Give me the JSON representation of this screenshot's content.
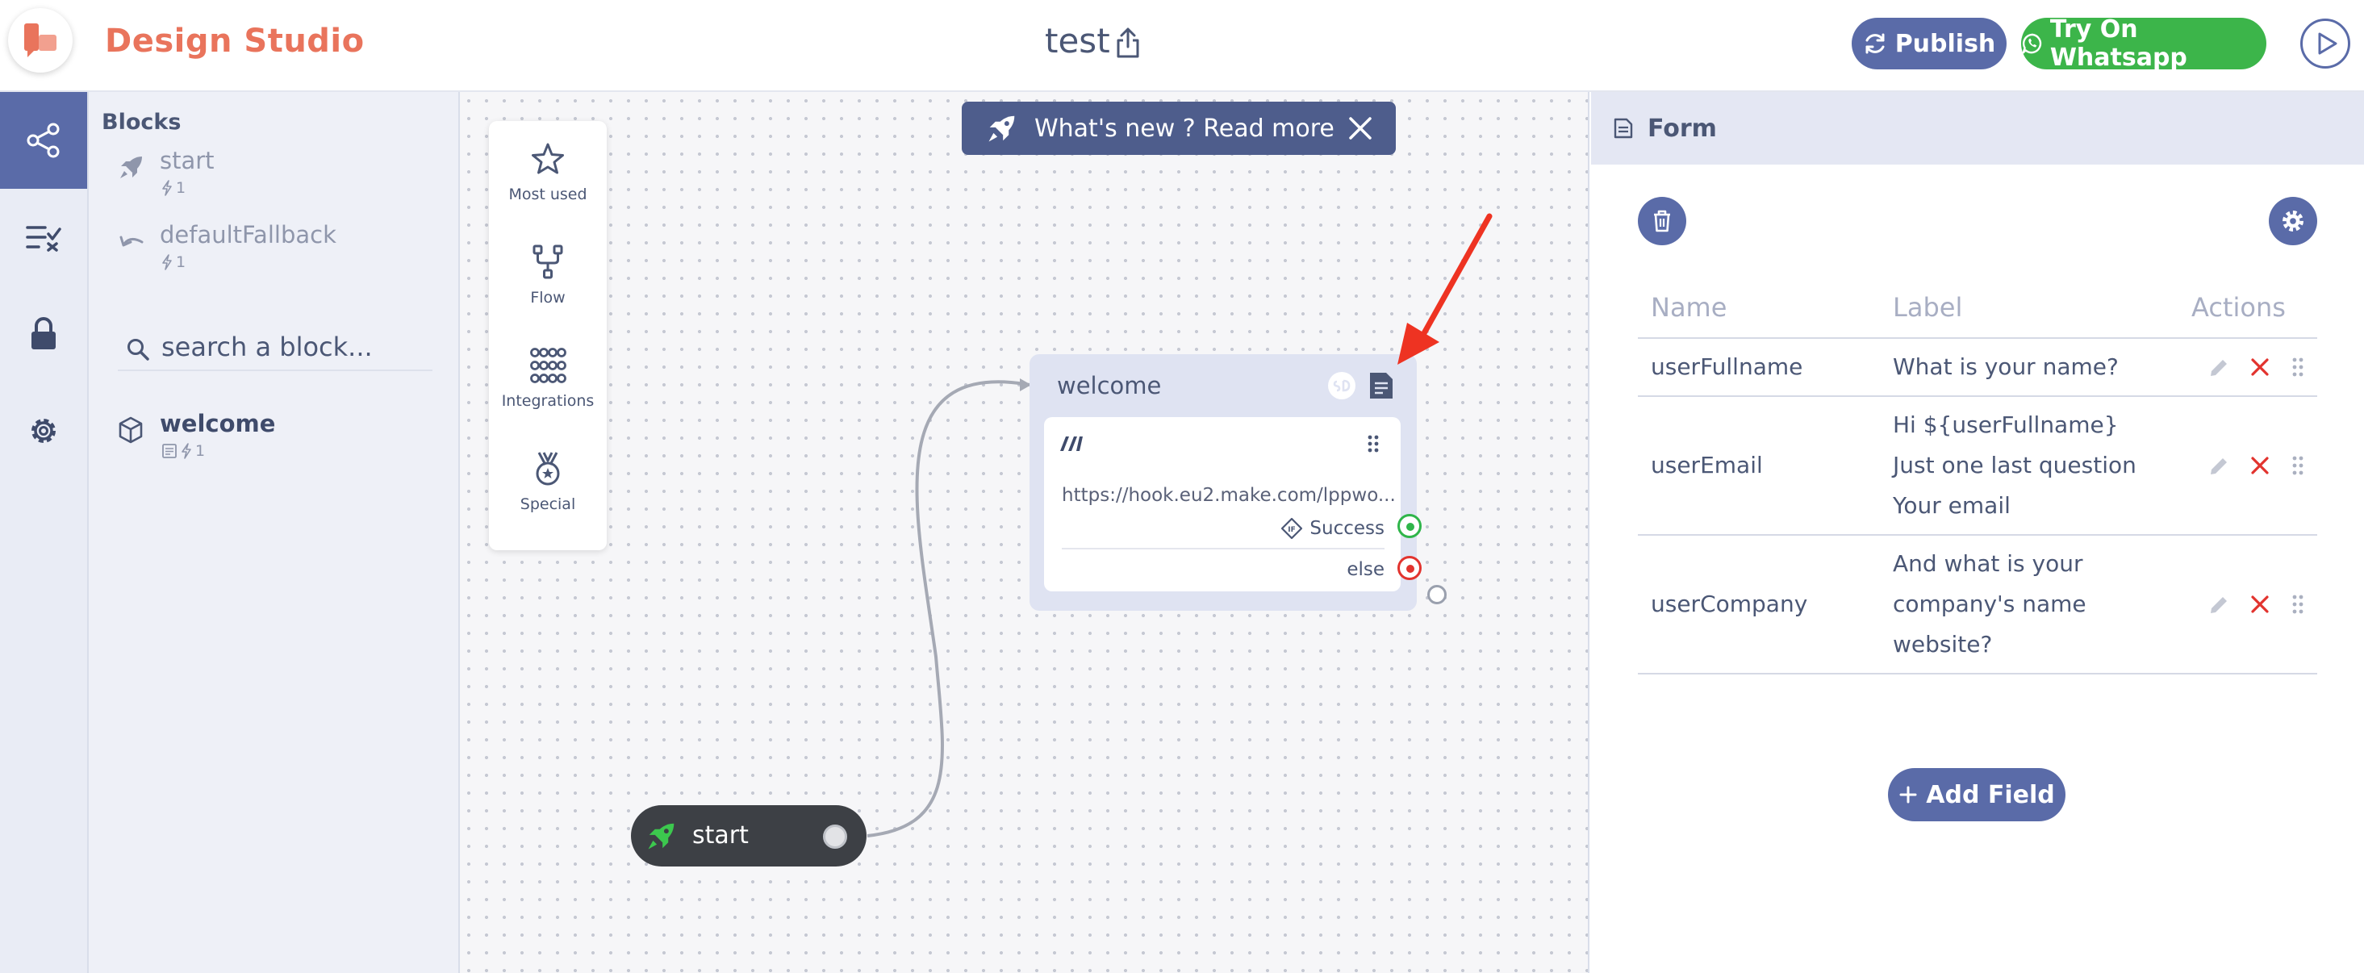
{
  "header": {
    "app_title": "Design Studio",
    "project_title": "test",
    "publish_label": "Publish",
    "whatsapp_label": "Try On Whatsapp"
  },
  "rail": {
    "items": [
      {
        "icon": "share-nodes-icon",
        "active": true
      },
      {
        "icon": "checklist-icon",
        "active": false
      },
      {
        "icon": "lock-icon",
        "active": false
      },
      {
        "icon": "gear-icon",
        "active": false
      }
    ]
  },
  "blocks_panel": {
    "title": "Blocks",
    "items": [
      {
        "name": "start",
        "meta": "1",
        "icon": "rocket-icon"
      },
      {
        "name": "defaultFallback",
        "meta": "1",
        "icon": "undo-icon"
      },
      {
        "name": "welcome",
        "meta": "1",
        "icon": "cube-icon"
      }
    ],
    "search_placeholder": "search a block..."
  },
  "palette": {
    "items": [
      {
        "label": "Most used",
        "icon": "star-icon"
      },
      {
        "label": "Flow",
        "icon": "flow-icon"
      },
      {
        "label": "Integrations",
        "icon": "grid-dots-icon"
      },
      {
        "label": "Special",
        "icon": "medal-icon"
      }
    ]
  },
  "banner": {
    "text": "What's new ? Read more"
  },
  "node": {
    "title": "welcome",
    "url": "https://hook.eu2.make.com/lppwo...",
    "success_label": "Success",
    "else_label": "else"
  },
  "start_node": {
    "label": "start"
  },
  "form_panel": {
    "title": "Form",
    "columns": [
      "Name",
      "Label",
      "Actions"
    ],
    "rows": [
      {
        "name": "userFullname",
        "label": "What is your name?"
      },
      {
        "name": "userEmail",
        "label": "Hi ${userFullname} Just one last question Your email"
      },
      {
        "name": "userCompany",
        "label": "And what is your company's name website?"
      }
    ],
    "add_field_label": "Add Field"
  },
  "colors": {
    "brand": "#e9745c",
    "primary": "#5a6ba8",
    "whatsapp": "#3cb54a",
    "success": "#2fb54a",
    "danger": "#e2332e",
    "annotation_arrow": "#ee3322"
  }
}
